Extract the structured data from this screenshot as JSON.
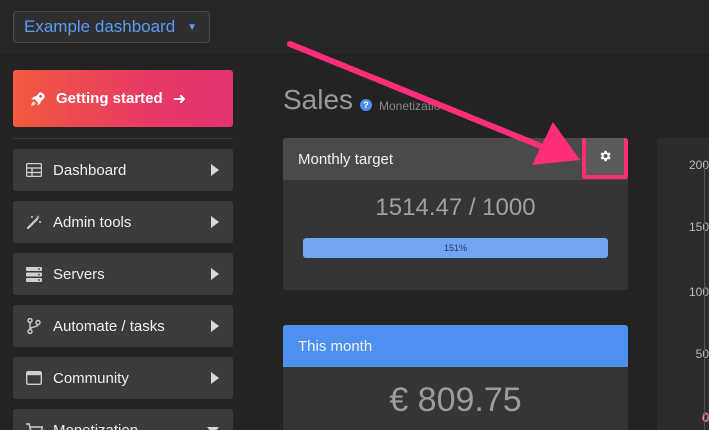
{
  "topbar": {
    "dashboard_select": "Example dashboard"
  },
  "sidebar": {
    "getting_started": "Getting started",
    "items": [
      {
        "label": "Dashboard",
        "icon": "grid-icon"
      },
      {
        "label": "Admin tools",
        "icon": "magic-wand-icon"
      },
      {
        "label": "Servers",
        "icon": "server-icon"
      },
      {
        "label": "Automate / tasks",
        "icon": "branch-icon"
      },
      {
        "label": "Community",
        "icon": "window-icon"
      },
      {
        "label": "Monetization",
        "icon": "cart-icon"
      }
    ]
  },
  "main": {
    "title": "Sales",
    "breadcrumb_sub": "Monetizatio",
    "monthly_target": {
      "header": "Monthly target",
      "value_text": "1514.47 / 1000",
      "progress_label": "151%",
      "progress_fraction": 1.0
    },
    "this_month": {
      "header": "This month",
      "value_text": "€ 809.75"
    }
  },
  "chart": {
    "y_ticks": [
      "200",
      "150",
      "100",
      "50",
      "0"
    ]
  },
  "colors": {
    "accent": "#4d90f0",
    "highlight": "#ff2e78",
    "gradient_start": "#f15a3e",
    "gradient_end": "#e3336f"
  }
}
